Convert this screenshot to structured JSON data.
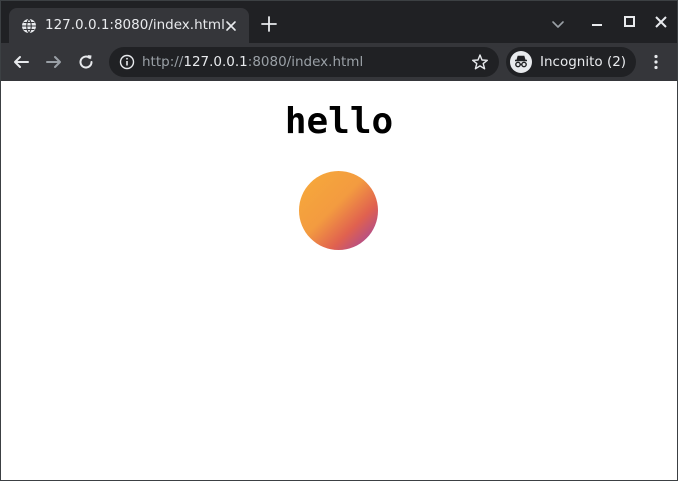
{
  "tab": {
    "title": "127.0.0.1:8080/index.html",
    "favicon": "globe-icon",
    "close_icon": "close-icon"
  },
  "tabstrip": {
    "new_tab_icon": "plus-icon",
    "tab_search_icon": "chevron-down-icon"
  },
  "window_controls": [
    "minimize-icon",
    "maximize-icon",
    "close-icon"
  ],
  "toolbar": {
    "back_icon": "arrow-left-icon",
    "forward_icon": "arrow-right-icon",
    "reload_icon": "reload-icon",
    "omnibox": {
      "info_icon": "info-icon",
      "scheme": "http://",
      "host": "127.0.0.1",
      "path": ":8080/index.html",
      "bookmark_icon": "star-icon"
    },
    "profile": {
      "icon": "incognito-icon",
      "label": "Incognito (2)"
    },
    "menu_icon": "more-vertical-icon"
  },
  "page": {
    "heading": "hello",
    "circle_gradient": [
      "#f7ab3a",
      "#e0614f",
      "#9540b0"
    ]
  },
  "colors": {
    "frame": "#202124",
    "toolbar": "#35363a",
    "text": "#e8eaed",
    "muted": "#9aa0a6"
  }
}
